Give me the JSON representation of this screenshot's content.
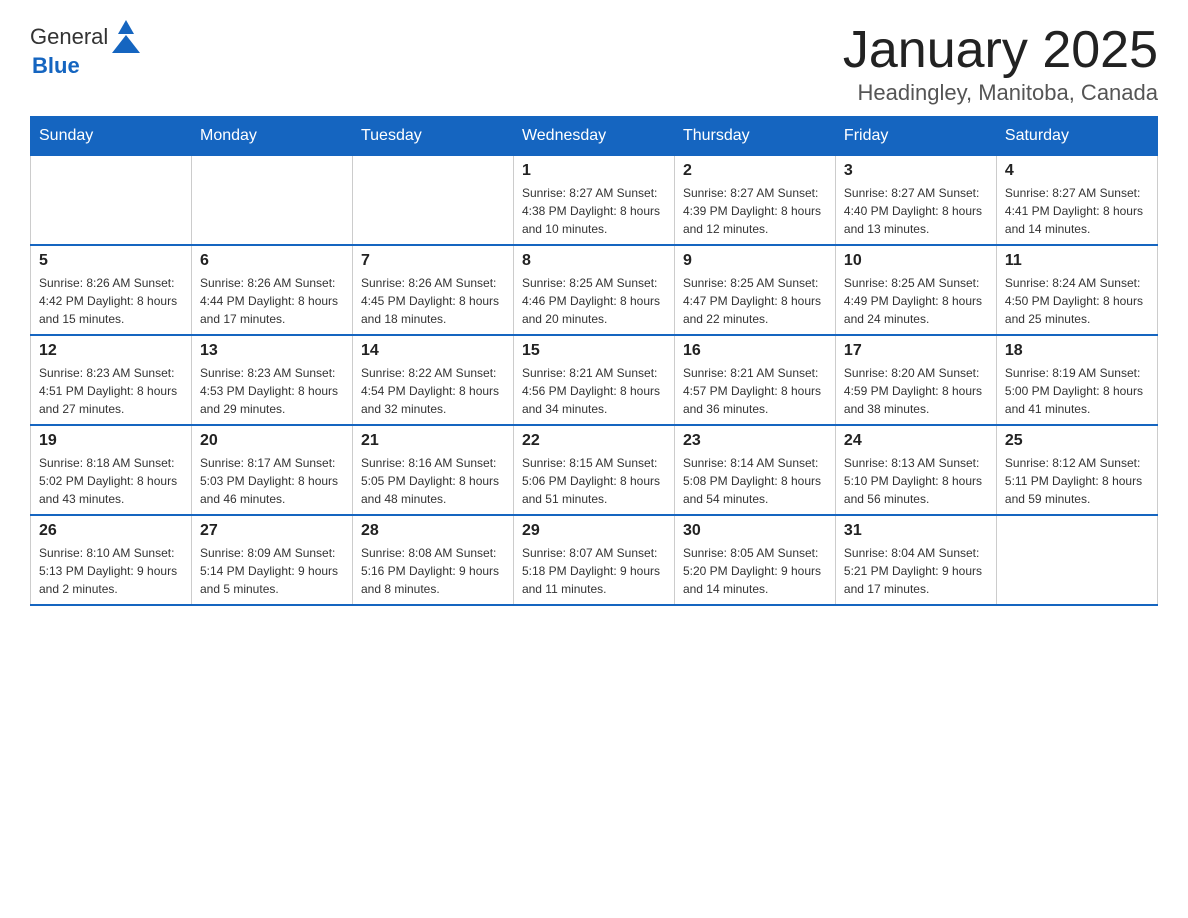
{
  "logo": {
    "text_general": "General",
    "text_blue": "Blue"
  },
  "header": {
    "month_title": "January 2025",
    "location": "Headingley, Manitoba, Canada"
  },
  "days_of_week": [
    "Sunday",
    "Monday",
    "Tuesday",
    "Wednesday",
    "Thursday",
    "Friday",
    "Saturday"
  ],
  "weeks": [
    [
      {
        "day": "",
        "info": ""
      },
      {
        "day": "",
        "info": ""
      },
      {
        "day": "",
        "info": ""
      },
      {
        "day": "1",
        "info": "Sunrise: 8:27 AM\nSunset: 4:38 PM\nDaylight: 8 hours\nand 10 minutes."
      },
      {
        "day": "2",
        "info": "Sunrise: 8:27 AM\nSunset: 4:39 PM\nDaylight: 8 hours\nand 12 minutes."
      },
      {
        "day": "3",
        "info": "Sunrise: 8:27 AM\nSunset: 4:40 PM\nDaylight: 8 hours\nand 13 minutes."
      },
      {
        "day": "4",
        "info": "Sunrise: 8:27 AM\nSunset: 4:41 PM\nDaylight: 8 hours\nand 14 minutes."
      }
    ],
    [
      {
        "day": "5",
        "info": "Sunrise: 8:26 AM\nSunset: 4:42 PM\nDaylight: 8 hours\nand 15 minutes."
      },
      {
        "day": "6",
        "info": "Sunrise: 8:26 AM\nSunset: 4:44 PM\nDaylight: 8 hours\nand 17 minutes."
      },
      {
        "day": "7",
        "info": "Sunrise: 8:26 AM\nSunset: 4:45 PM\nDaylight: 8 hours\nand 18 minutes."
      },
      {
        "day": "8",
        "info": "Sunrise: 8:25 AM\nSunset: 4:46 PM\nDaylight: 8 hours\nand 20 minutes."
      },
      {
        "day": "9",
        "info": "Sunrise: 8:25 AM\nSunset: 4:47 PM\nDaylight: 8 hours\nand 22 minutes."
      },
      {
        "day": "10",
        "info": "Sunrise: 8:25 AM\nSunset: 4:49 PM\nDaylight: 8 hours\nand 24 minutes."
      },
      {
        "day": "11",
        "info": "Sunrise: 8:24 AM\nSunset: 4:50 PM\nDaylight: 8 hours\nand 25 minutes."
      }
    ],
    [
      {
        "day": "12",
        "info": "Sunrise: 8:23 AM\nSunset: 4:51 PM\nDaylight: 8 hours\nand 27 minutes."
      },
      {
        "day": "13",
        "info": "Sunrise: 8:23 AM\nSunset: 4:53 PM\nDaylight: 8 hours\nand 29 minutes."
      },
      {
        "day": "14",
        "info": "Sunrise: 8:22 AM\nSunset: 4:54 PM\nDaylight: 8 hours\nand 32 minutes."
      },
      {
        "day": "15",
        "info": "Sunrise: 8:21 AM\nSunset: 4:56 PM\nDaylight: 8 hours\nand 34 minutes."
      },
      {
        "day": "16",
        "info": "Sunrise: 8:21 AM\nSunset: 4:57 PM\nDaylight: 8 hours\nand 36 minutes."
      },
      {
        "day": "17",
        "info": "Sunrise: 8:20 AM\nSunset: 4:59 PM\nDaylight: 8 hours\nand 38 minutes."
      },
      {
        "day": "18",
        "info": "Sunrise: 8:19 AM\nSunset: 5:00 PM\nDaylight: 8 hours\nand 41 minutes."
      }
    ],
    [
      {
        "day": "19",
        "info": "Sunrise: 8:18 AM\nSunset: 5:02 PM\nDaylight: 8 hours\nand 43 minutes."
      },
      {
        "day": "20",
        "info": "Sunrise: 8:17 AM\nSunset: 5:03 PM\nDaylight: 8 hours\nand 46 minutes."
      },
      {
        "day": "21",
        "info": "Sunrise: 8:16 AM\nSunset: 5:05 PM\nDaylight: 8 hours\nand 48 minutes."
      },
      {
        "day": "22",
        "info": "Sunrise: 8:15 AM\nSunset: 5:06 PM\nDaylight: 8 hours\nand 51 minutes."
      },
      {
        "day": "23",
        "info": "Sunrise: 8:14 AM\nSunset: 5:08 PM\nDaylight: 8 hours\nand 54 minutes."
      },
      {
        "day": "24",
        "info": "Sunrise: 8:13 AM\nSunset: 5:10 PM\nDaylight: 8 hours\nand 56 minutes."
      },
      {
        "day": "25",
        "info": "Sunrise: 8:12 AM\nSunset: 5:11 PM\nDaylight: 8 hours\nand 59 minutes."
      }
    ],
    [
      {
        "day": "26",
        "info": "Sunrise: 8:10 AM\nSunset: 5:13 PM\nDaylight: 9 hours\nand 2 minutes."
      },
      {
        "day": "27",
        "info": "Sunrise: 8:09 AM\nSunset: 5:14 PM\nDaylight: 9 hours\nand 5 minutes."
      },
      {
        "day": "28",
        "info": "Sunrise: 8:08 AM\nSunset: 5:16 PM\nDaylight: 9 hours\nand 8 minutes."
      },
      {
        "day": "29",
        "info": "Sunrise: 8:07 AM\nSunset: 5:18 PM\nDaylight: 9 hours\nand 11 minutes."
      },
      {
        "day": "30",
        "info": "Sunrise: 8:05 AM\nSunset: 5:20 PM\nDaylight: 9 hours\nand 14 minutes."
      },
      {
        "day": "31",
        "info": "Sunrise: 8:04 AM\nSunset: 5:21 PM\nDaylight: 9 hours\nand 17 minutes."
      },
      {
        "day": "",
        "info": ""
      }
    ]
  ]
}
